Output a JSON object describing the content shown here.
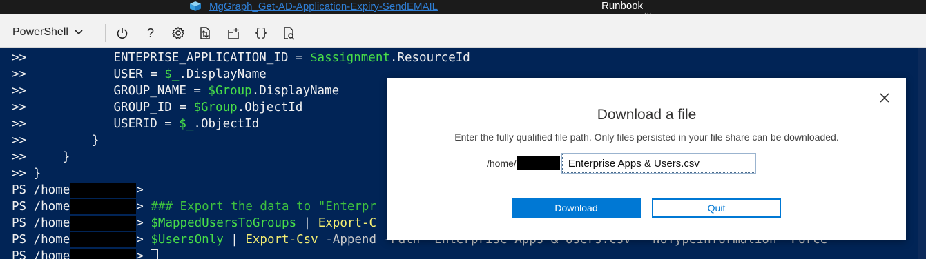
{
  "titlebar": {
    "tab_title": "MgGraph_Get-AD-Application-Expiry-SendEMAIL",
    "runbook_label": "Runbook",
    "ellipsis": "..."
  },
  "toolbar": {
    "shell": "PowerShell",
    "help": "?",
    "braces": "{}",
    "icons": [
      "power-icon",
      "help-icon",
      "settings-icon",
      "upload-download-icon",
      "open-editor-icon",
      "braces-icon",
      "preview-icon"
    ]
  },
  "terminal": {
    "lines": [
      {
        "prompt": ">>",
        "indent": "            ",
        "a": "ENTEPRISE_APPLICATION_ID = ",
        "var": "$assignment",
        "b": ".ResourceId"
      },
      {
        "prompt": ">>",
        "indent": "            ",
        "a": "USER = ",
        "var": "$_",
        "b": ".DisplayName"
      },
      {
        "prompt": ">>",
        "indent": "            ",
        "a": "GROUP_NAME = ",
        "var": "$Group",
        "b": ".DisplayName"
      },
      {
        "prompt": ">>",
        "indent": "            ",
        "a": "GROUP_ID = ",
        "var": "$Group",
        "b": ".ObjectId"
      },
      {
        "prompt": ">>",
        "indent": "            ",
        "a": "USERID = ",
        "var": "$_",
        "b": ".ObjectId"
      },
      {
        "prompt": ">>",
        "indent": "         ",
        "a": "}",
        "var": "",
        "b": ""
      },
      {
        "prompt": ">>",
        "indent": "     ",
        "a": "}",
        "var": "",
        "b": ""
      },
      {
        "prompt": ">>",
        "indent": " ",
        "a": "}",
        "var": "",
        "b": ""
      }
    ],
    "ps_prefix": "PS /home",
    "ps_suffix": ">",
    "cmd_line1_comment": "### Export the data to \"Enterpr",
    "cmd_line2_var": "$MappedUsersToGroups",
    "cmd_line2_pipe": " | ",
    "cmd_line2_cmd": "Export-C",
    "cmd_line3_var": "$UsersOnly",
    "cmd_line3_pipe": " | ",
    "cmd_line3_cmd": "Export-Csv",
    "cmd_line3_rest": " -Append -Path \"Enterprise Apps & Users.csv\" -NoTypeInformation -Force"
  },
  "dialog": {
    "title": "Download a file",
    "description": "Enter the fully qualified file path. Only files persisted in your file share can be downloaded.",
    "path_prefix": "/home/",
    "file_value": "Enterprise Apps & Users.csv",
    "download_label": "Download",
    "quit_label": "Quit",
    "accent": "#0078d4"
  }
}
